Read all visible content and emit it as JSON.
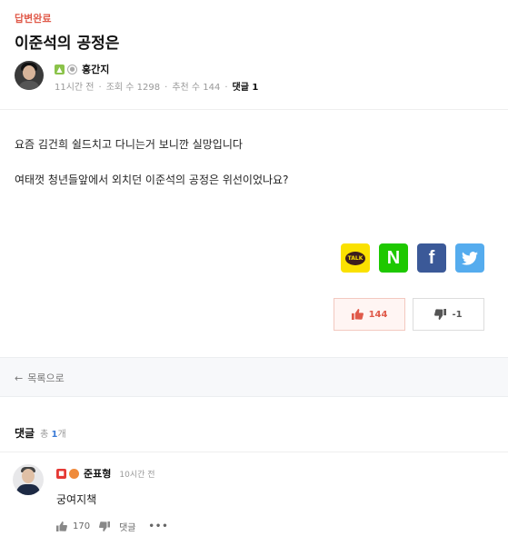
{
  "post": {
    "status": "답변완료",
    "title": "이준석의 공정은",
    "author": "홍간지",
    "time": "11시간 전",
    "views": "조회 수 1298",
    "recommends": "추천 수 144",
    "comments_label": "댓글 1",
    "body_lines": [
      "요즘 김건희 쉴드치고 다니는거 보니깐 실망입니다",
      "여태껏 청년들앞에서 외치던 이준석의 공정은 위선이었나요?"
    ]
  },
  "share": {
    "kakao_label": "TALK",
    "naver_label": "N",
    "facebook_label": "f"
  },
  "votes": {
    "up": "144",
    "down": "-1"
  },
  "nav": {
    "back_label": "목록으로"
  },
  "comments": {
    "title": "댓글",
    "total_prefix": "총",
    "total_count": "1",
    "total_suffix": "개",
    "items": [
      {
        "author": "준표형",
        "time": "10시간 전",
        "text": "궁여지책",
        "likes": "170",
        "reply_label": "댓글",
        "more": "•••"
      }
    ]
  },
  "colors": {
    "accent_red": "#e05a4a",
    "kakao_yellow": "#fae100",
    "naver_green": "#1ec800",
    "facebook_blue": "#3b5998",
    "twitter_blue": "#55acee",
    "count_blue": "#3b7bd6"
  }
}
